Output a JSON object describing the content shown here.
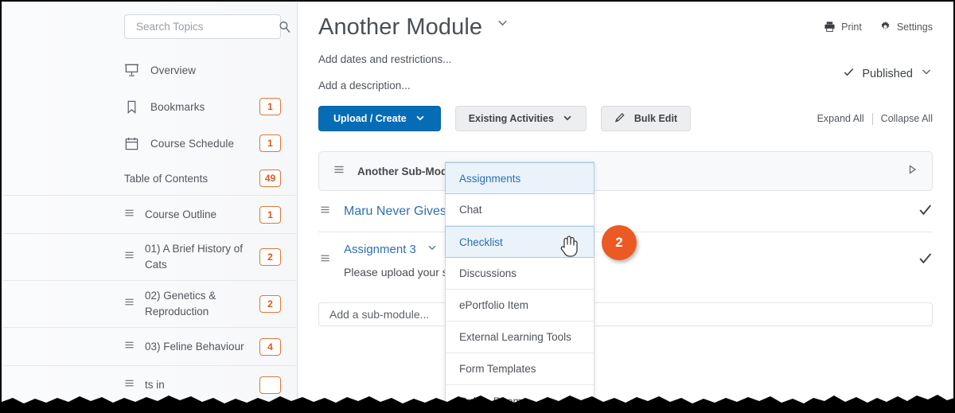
{
  "sidebar": {
    "search": {
      "placeholder": "Search Topics",
      "value": "",
      "icon": "search-icon"
    },
    "nav": [
      {
        "label": "Overview",
        "icon": "presentation-icon",
        "badge": ""
      },
      {
        "label": "Bookmarks",
        "icon": "bookmark-icon",
        "badge": "1"
      },
      {
        "label": "Course Schedule",
        "icon": "calendar-icon",
        "badge": "1"
      }
    ],
    "toc": {
      "label": "Table of Contents",
      "badge": "49"
    },
    "toc_items": [
      {
        "label": "Course Outline",
        "badge": "1",
        "icon": "drag-handle-icon"
      },
      {
        "label": "01) A Brief History of Cats",
        "badge": "2",
        "icon": "drag-handle-icon"
      },
      {
        "label": "02) Genetics & Reproduction",
        "badge": "2",
        "icon": "drag-handle-icon"
      },
      {
        "label": "03) Feline Behaviour",
        "badge": "4",
        "icon": "drag-handle-icon"
      },
      {
        "label": "ts in",
        "badge": "",
        "icon": "drag-handle-icon"
      }
    ]
  },
  "header": {
    "title": "Another Module",
    "title_caret": "chevron-down-icon",
    "print_label": "Print",
    "settings_label": "Settings",
    "dates_label": "Add dates and restrictions...",
    "description_label": "Add a description...",
    "published_label": "Published",
    "published_check": "check-icon",
    "published_caret": "chevron-down-icon"
  },
  "toolbar": {
    "upload_create": "Upload / Create",
    "existing_activities": "Existing Activities",
    "bulk_edit": "Bulk Edit",
    "expand_all": "Expand All",
    "collapse_all": "Collapse All"
  },
  "content": {
    "submodule": {
      "name": "Another Sub-Module",
      "expander": "triangle-right-icon"
    },
    "items": [
      {
        "title": "Maru Never Gives Up",
        "desc": "",
        "caret": "",
        "status": "check-icon"
      },
      {
        "title": "Assignment 3",
        "desc": "Please upload your su                 ) format only.",
        "caret": "chevron-down-icon",
        "status": "check-icon"
      }
    ],
    "add_submodule_placeholder": "Add a sub-module..."
  },
  "dropdown": {
    "items": [
      {
        "label": "Assignments",
        "selected": true
      },
      {
        "label": "Chat",
        "selected": false
      },
      {
        "label": "Checklist",
        "selected": true
      },
      {
        "label": "Discussions",
        "selected": false
      },
      {
        "label": "ePortfolio Item",
        "selected": false
      },
      {
        "label": "External Learning Tools",
        "selected": false
      },
      {
        "label": "Form Templates",
        "selected": false
      },
      {
        "label": "Online Rooms",
        "selected": false
      }
    ]
  },
  "annotation": {
    "step_number": "2"
  },
  "colors": {
    "primary_button": "#066cb5",
    "link": "#2f6fb5",
    "badge_orange": "#d9571f",
    "step_badge": "#ec5a23",
    "selected_row_bg": "#eaf3fa"
  }
}
